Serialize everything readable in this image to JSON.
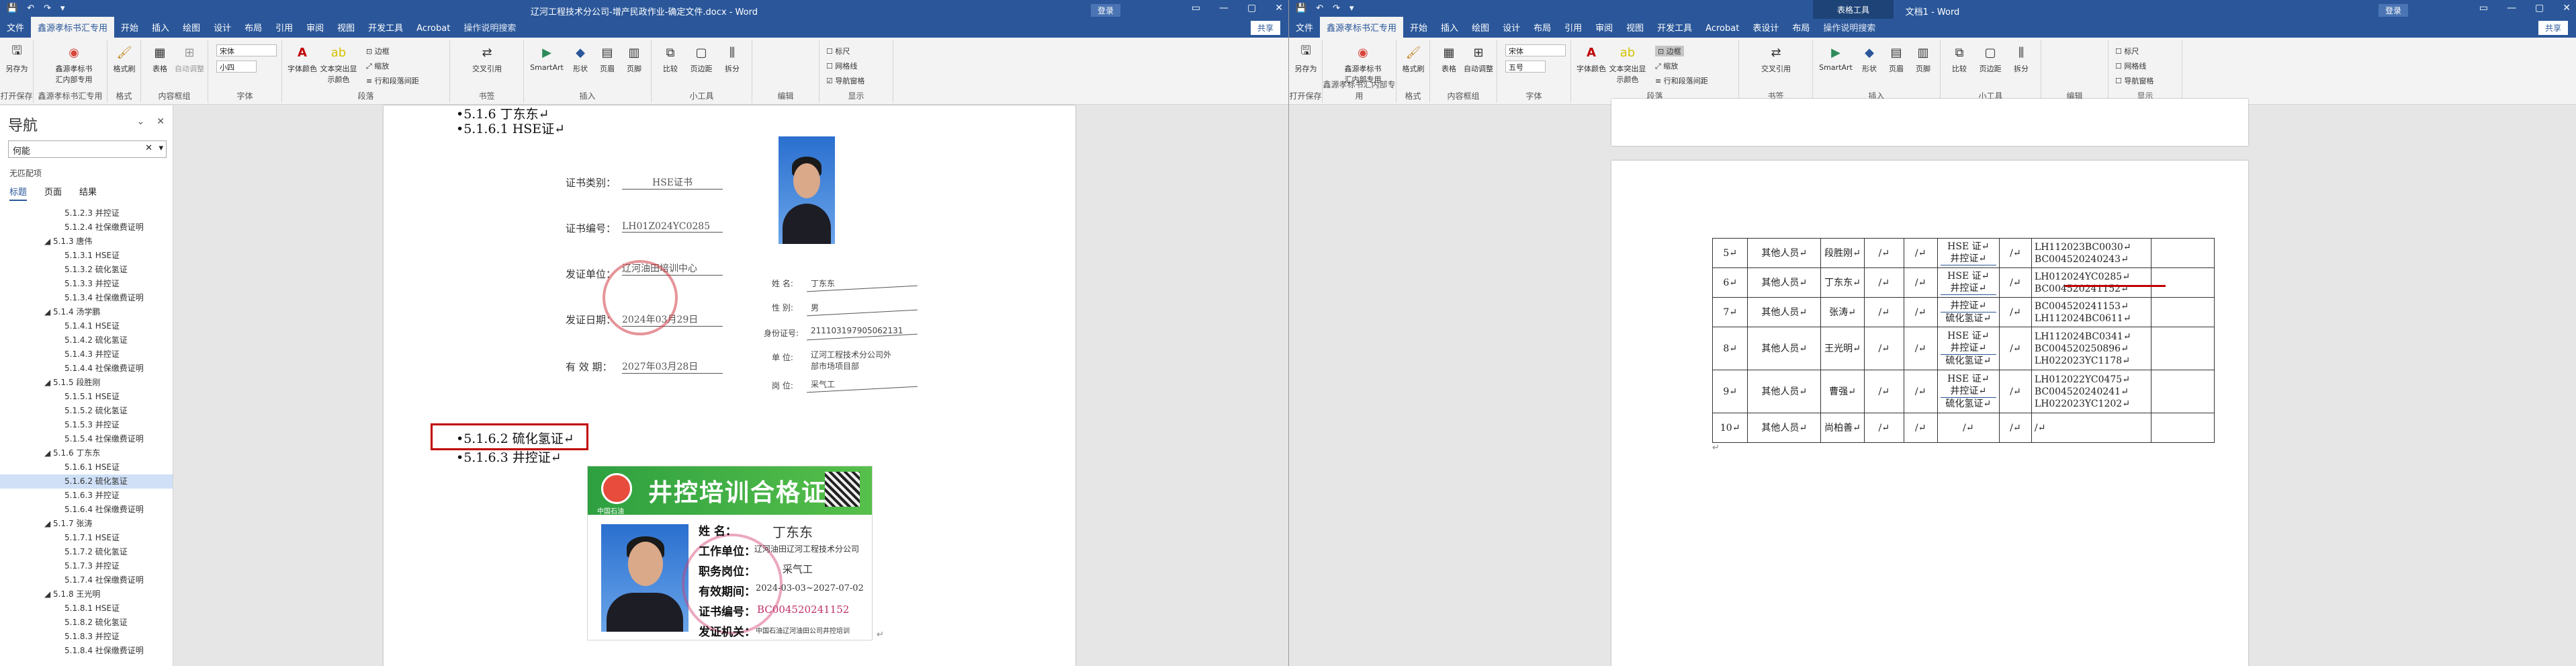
{
  "left": {
    "quick_access": [
      "💾",
      "↶",
      "↷",
      "▾"
    ],
    "title": "辽河工程技术分公司-增产民政作业-确定文件.docx - Word",
    "user": "登录",
    "window_controls": [
      "▭",
      "—",
      "▢",
      "✕"
    ],
    "menus": [
      "文件",
      "鑫源孝标书汇专用",
      "开始",
      "插入",
      "绘图",
      "设计",
      "布局",
      "引用",
      "审阅",
      "视图",
      "开发工具",
      "Acrobat"
    ],
    "help": "操作说明搜索",
    "share": "共享",
    "ribbon_buttons": [
      "另存为",
      "鑫源孝标书汇内部专用",
      "格式刷",
      "表格",
      "自动调整",
      "字体颜色",
      "文本突出显示颜色",
      "边框",
      "缩放",
      "行和段落间距",
      "交叉引用",
      "SmartArt",
      "形状",
      "页眉",
      "页脚",
      "比较",
      "页边距",
      "拆分",
      "标尺",
      "网格线",
      "导航窗格"
    ],
    "font_name": "宋体",
    "font_size": "小四",
    "group_labels": [
      "打开保存",
      "鑫源孝标书汇专用",
      "格式",
      "内容框组",
      "字体",
      "段落",
      "书签",
      "插入",
      "小工具",
      "编辑",
      "显示"
    ],
    "nav": {
      "title": "导航",
      "search_value": "何能",
      "no_results": "无匹配项",
      "tabs": [
        "标题",
        "页面",
        "结果"
      ],
      "tree": [
        {
          "t": "5.1.2.3 并控证",
          "l": 3
        },
        {
          "t": "5.1.2.4 社保缴费证明",
          "l": 3
        },
        {
          "t": "◢ 5.1.3 唐伟",
          "l": 2
        },
        {
          "t": "5.1.3.1 HSE证",
          "l": 3
        },
        {
          "t": "5.1.3.2 硫化氢证",
          "l": 3
        },
        {
          "t": "5.1.3.3 并控证",
          "l": 3
        },
        {
          "t": "5.1.3.4 社保缴费证明",
          "l": 3
        },
        {
          "t": "◢ 5.1.4 汤学鹏",
          "l": 2
        },
        {
          "t": "5.1.4.1 HSE证",
          "l": 3
        },
        {
          "t": "5.1.4.2 硫化氢证",
          "l": 3
        },
        {
          "t": "5.1.4.3 并控证",
          "l": 3
        },
        {
          "t": "5.1.4.4 社保缴费证明",
          "l": 3
        },
        {
          "t": "◢ 5.1.5 段胜刚",
          "l": 2
        },
        {
          "t": "5.1.5.1 HSE证",
          "l": 3
        },
        {
          "t": "5.1.5.2 硫化氢证",
          "l": 3
        },
        {
          "t": "5.1.5.3 并控证",
          "l": 3
        },
        {
          "t": "5.1.5.4 社保缴费证明",
          "l": 3
        },
        {
          "t": "◢ 5.1.6 丁东东",
          "l": 2
        },
        {
          "t": "5.1.6.1 HSE证",
          "l": 3
        },
        {
          "t": "5.1.6.2 硫化氢证",
          "l": 3,
          "sel": true
        },
        {
          "t": "5.1.6.3 并控证",
          "l": 3
        },
        {
          "t": "5.1.6.4 社保缴费证明",
          "l": 3
        },
        {
          "t": "◢ 5.1.7 张涛",
          "l": 2
        },
        {
          "t": "5.1.7.1 HSE证",
          "l": 3
        },
        {
          "t": "5.1.7.2 硫化氢证",
          "l": 3
        },
        {
          "t": "5.1.7.3 并控证",
          "l": 3
        },
        {
          "t": "5.1.7.4 社保缴费证明",
          "l": 3
        },
        {
          "t": "◢ 5.1.8 王光明",
          "l": 2
        },
        {
          "t": "5.1.8.1 HSE证",
          "l": 3
        },
        {
          "t": "5.1.8.2 硫化氢证",
          "l": 3
        },
        {
          "t": "5.1.8.3 并控证",
          "l": 3
        },
        {
          "t": "5.1.8.4 社保缴费证明",
          "l": 3
        }
      ]
    },
    "doc": {
      "h_516": "•5.1.6  丁东东↵",
      "h_5161": "•5.1.6.1  HSE证↵",
      "h_5162": "•5.1.6.2  硫化氢证↵",
      "h_5163": "•5.1.6.3  井控证↵",
      "hse": {
        "l1": "证书类别：",
        "v1": "HSE证书",
        "l2": "证书编号：",
        "v2": "LH01Z024YC0285",
        "l3": "发证单位：",
        "v3": "辽河油田培训中心",
        "l4": "发证日期：",
        "v4": "2024年03月29日",
        "l5": "有 效 期：",
        "v5": "2027年03月28日",
        "r_name_l": "姓  名:",
        "r_name_v": "丁东东",
        "r_sex_l": "性  别:",
        "r_sex_v": "男",
        "r_id_l": "身份证号:",
        "r_id_v": "211103197905062131",
        "r_unit_l": "单  位:",
        "r_unit_v": "辽河工程技术分公司外部市场项目部",
        "r_job_l": "岗  位:",
        "r_job_v": "采气工"
      },
      "card": {
        "title": "井控培训合格证",
        "org": "中国石油",
        "l_name": "姓    名：",
        "v_name": "丁东东",
        "l_unit": "工作单位：",
        "v_unit": "辽河油田辽河工程技术分公司",
        "l_post": "职务岗位：",
        "v_post": "采气工",
        "l_valid": "有效期间：",
        "v_valid": "2024-03-03~2027-07-02",
        "l_no": "证书编号：",
        "v_no": "BC004520241152",
        "l_issuer": "发证机关：",
        "v_issuer": "中国石油辽河油田公司井控培训",
        "ret": "↵"
      }
    }
  },
  "right": {
    "quick_access": [
      "💾",
      "↶",
      "↷",
      "▾"
    ],
    "title": "文档1 - Word",
    "context_tab": "表格工具",
    "user": "登录",
    "window_controls": [
      "▭",
      "—",
      "▢",
      "✕"
    ],
    "menus": [
      "文件",
      "鑫源孝标书汇专用",
      "开始",
      "插入",
      "绘图",
      "设计",
      "布局",
      "引用",
      "审阅",
      "视图",
      "开发工具",
      "Acrobat",
      "表设计",
      "布局"
    ],
    "help": "操作说明搜索",
    "share": "共享",
    "font_name": "宋体",
    "font_size": "五号",
    "group_labels": [
      "打开保存",
      "鑫源孝标书汇内部专用",
      "格式",
      "内容框组",
      "字体",
      "段落",
      "书签",
      "插入",
      "小工具",
      "编辑",
      "显示"
    ],
    "table": {
      "rows": [
        {
          "no": "5↵",
          "type": "其他人员↵",
          "name": "段胜刚↵",
          "c4": "/↵",
          "c5": "/↵",
          "certs": [
            "HSE 证↵",
            "井控证↵"
          ],
          "c7": "/↵",
          "nums": [
            "LH112023BC0030↵",
            "BC004520240243↵"
          ]
        },
        {
          "no": "6↵",
          "type": "其他人员↵",
          "name": "丁东东↵",
          "c4": "/↵",
          "c5": "/↵",
          "certs": [
            "HSE 证↵",
            "井控证↵"
          ],
          "c7": "/↵",
          "nums": [
            "LH012024YC0285↵",
            "BC004520241152↵"
          ]
        },
        {
          "no": "7↵",
          "type": "其他人员↵",
          "name": "张涛↵",
          "c4": "/↵",
          "c5": "/↵",
          "certs": [
            "井控证↵",
            "硫化氢证↵"
          ],
          "c7": "/↵",
          "nums": [
            "BC004520241153↵",
            "LH112024BC0611↵"
          ]
        },
        {
          "no": "8↵",
          "type": "其他人员↵",
          "name": "王光明↵",
          "c4": "/↵",
          "c5": "/↵",
          "certs": [
            "HSE 证↵",
            "井控证↵",
            "硫化氢证↵"
          ],
          "c7": "/↵",
          "nums": [
            "LH112024BC0341↵",
            "BC004520250896↵",
            "LH022023YC1178↵"
          ]
        },
        {
          "no": "9↵",
          "type": "其他人员↵",
          "name": "曹强↵",
          "c4": "/↵",
          "c5": "/↵",
          "certs": [
            "HSE 证↵",
            "井控证↵",
            "硫化氢证↵"
          ],
          "c7": "/↵",
          "nums": [
            "LH012022YC0475↵",
            "BC004520240241↵",
            "LH022023YC1202↵"
          ]
        },
        {
          "no": "10↵",
          "type": "其他人员↵",
          "name": "尚柏善↵",
          "c4": "/↵",
          "c5": "/↵",
          "certs": [
            "/↵"
          ],
          "c7": "/↵",
          "nums": [
            "/↵"
          ]
        }
      ],
      "end_mark": "↵"
    }
  }
}
